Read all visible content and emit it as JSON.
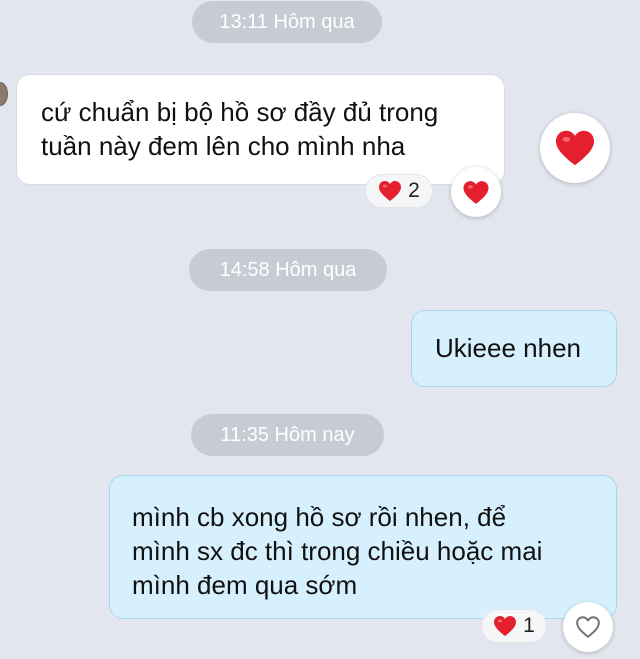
{
  "timestamps": [
    "13:11 Hôm qua",
    "14:58 Hôm qua",
    "11:35 Hôm nay"
  ],
  "messages": [
    {
      "direction": "incoming",
      "lines": [
        "cứ chuẩn bị bộ hồ sơ đầy đủ trong",
        "tuần này đem lên cho mình nha"
      ],
      "reaction_count": "2",
      "reacted_by_me": true
    },
    {
      "direction": "outgoing",
      "lines": [
        "Ukieee nhen"
      ]
    },
    {
      "direction": "outgoing",
      "lines": [
        "mình cb xong hồ sơ rồi nhen, để",
        "mình sx đc thì trong chiều hoặc mai",
        "mình đem qua sớm"
      ],
      "reaction_count": "1",
      "reacted_by_me": false
    }
  ],
  "icons": {
    "reaction": "red-heart-icon",
    "react_empty": "heart-outline-icon"
  },
  "colors": {
    "background": "#e3e6ee",
    "incoming_bubble": "#ffffff",
    "outgoing_bubble": "#d6f0fd",
    "heart": "#e5202e"
  }
}
